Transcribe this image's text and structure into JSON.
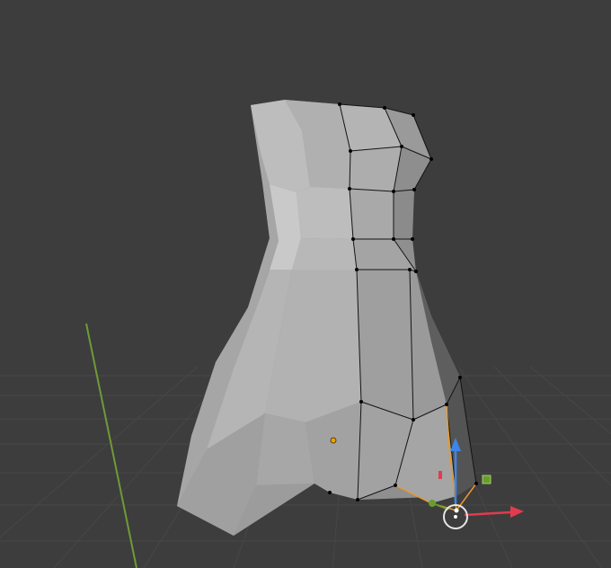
{
  "viewport": {
    "mode": "edit-mode",
    "object": "mesh",
    "background_color": "#3d3d3d",
    "grid_color": "#474747",
    "y_axis_color": "#6f9a38",
    "x_arrow_color": "#e23b4e",
    "z_arrow_color": "#3d86e8",
    "y_handle_color": "#6a9c2e",
    "selection_color": "#e69a2e",
    "origin_color": "#f0a000",
    "vertex_color": "#000000",
    "edge_color": "#141414"
  },
  "gizmo": {
    "type": "move",
    "axes": [
      "x-axis-arrow",
      "y-axis-handle",
      "z-axis-arrow"
    ],
    "pivot": "transform-center-ring"
  }
}
